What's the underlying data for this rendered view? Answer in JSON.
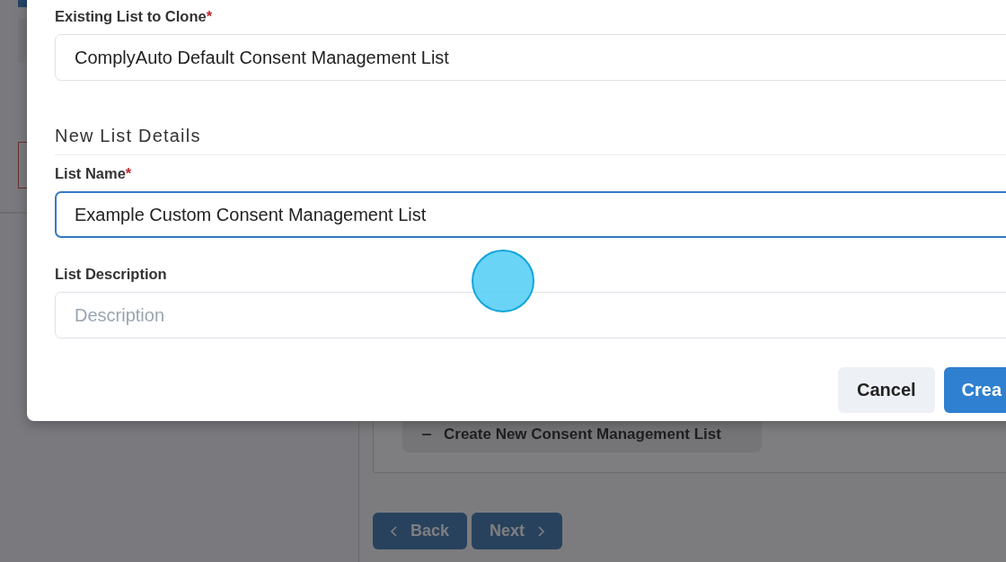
{
  "background": {
    "create_button": "Create New Consent Management List",
    "back_button": "Back",
    "next_button": "Next"
  },
  "modal": {
    "clone_field": {
      "label": "Existing List to Clone",
      "required_mark": "*",
      "value": "ComplyAuto Default Consent Management List"
    },
    "section_title": "New List Details",
    "name_field": {
      "label": "List Name",
      "required_mark": "*",
      "value": "Example Custom Consent Management List",
      "focused": true
    },
    "description_field": {
      "label": "List Description",
      "placeholder": "Description",
      "focused": false
    },
    "buttons": [
      {
        "label": "Cancel",
        "kind": "secondary"
      },
      {
        "label": "Crea",
        "kind": "primary"
      }
    ]
  }
}
